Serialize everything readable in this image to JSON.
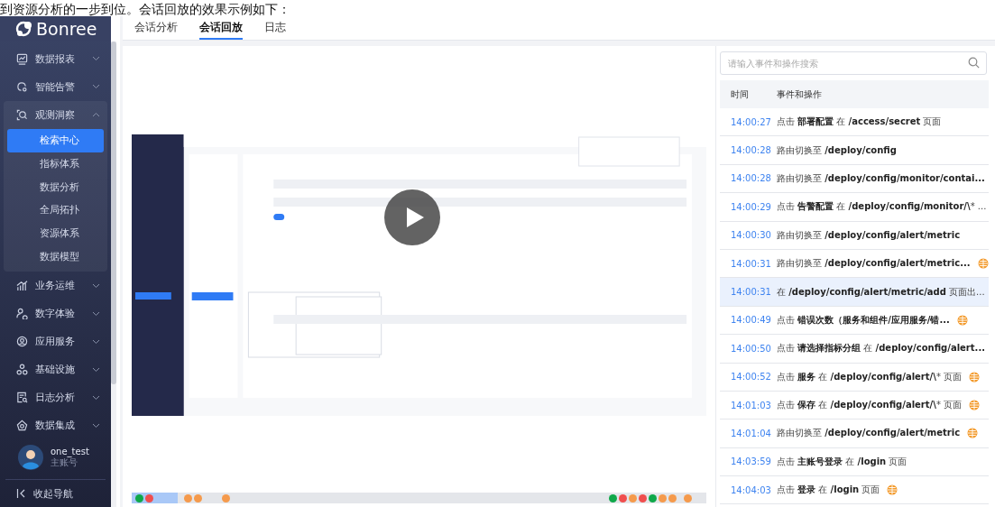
{
  "caption": "到资源分析的一步到位。会话回放的效果示例如下：",
  "sidebar": {
    "logo": "Bonree",
    "items": [
      {
        "label": "数据报表",
        "expanded": false
      },
      {
        "label": "智能告警",
        "expanded": false
      },
      {
        "label": "观测洞察",
        "expanded": true,
        "children": [
          {
            "label": "检索中心",
            "selected": true
          },
          {
            "label": "指标体系",
            "selected": false
          },
          {
            "label": "数据分析",
            "selected": false
          },
          {
            "label": "全局拓扑",
            "selected": false
          },
          {
            "label": "资源体系",
            "selected": false
          },
          {
            "label": "数据模型",
            "selected": false
          }
        ]
      },
      {
        "label": "业务运维",
        "expanded": false
      },
      {
        "label": "数字体验",
        "expanded": false
      },
      {
        "label": "应用服务",
        "expanded": false
      },
      {
        "label": "基础设施",
        "expanded": false
      },
      {
        "label": "日志分析",
        "expanded": false
      },
      {
        "label": "数据集成",
        "expanded": false
      }
    ],
    "user": {
      "name": "one_test",
      "role": "主账号"
    },
    "collapse": "收起导航"
  },
  "tabs": [
    {
      "label": "会话分析",
      "selected": false
    },
    {
      "label": "会话回放",
      "selected": true
    },
    {
      "label": "日志",
      "selected": false
    }
  ],
  "player": {
    "timeline": {
      "level": 0.08,
      "clusters": [
        {
          "markers": [
            {
              "color": "#0fa84a"
            },
            {
              "color": "#f04e4e"
            }
          ]
        },
        {
          "markers": [
            {
              "color": "#f59a4c"
            },
            {
              "color": "#f59a4c"
            }
          ]
        },
        {
          "markers": [
            {
              "color": "#f59a4c"
            }
          ]
        },
        {
          "markers": [
            {
              "color": "#0fa84a"
            },
            {
              "color": "#f04e4e"
            },
            {
              "color": "#f59a4c"
            },
            {
              "color": "#f04e4e"
            },
            {
              "color": "#0fa84a"
            },
            {
              "color": "#f59a4c"
            },
            {
              "color": "#f59a4c"
            }
          ]
        },
        {
          "markers": [
            {
              "color": "#f59a4c"
            }
          ]
        }
      ]
    }
  },
  "events": {
    "search": {
      "placeholder": "请输入事件和操作搜索"
    },
    "columns": [
      "时间",
      "事件和操作"
    ],
    "rows": [
      {
        "time": "14:00:27",
        "text": "点击 **部署配置** 在 **/access/secret** 页面",
        "web": false,
        "selected": false
      },
      {
        "time": "14:00:28",
        "text": "路由切换至 **/deploy/config**",
        "web": false,
        "selected": false
      },
      {
        "time": "14:00:28",
        "text": "路由切换至 **/deploy/config/monitor/contai...**",
        "web": false,
        "selected": false
      },
      {
        "time": "14:00:29",
        "text": "点击 **告警配置** 在 **/deploy/config/monitor/\\*** ...",
        "web": false,
        "selected": false
      },
      {
        "time": "14:00:30",
        "text": "路由切换至 **/deploy/config/alert/metric**",
        "web": false,
        "selected": false
      },
      {
        "time": "14:00:31",
        "text": "路由切换至 **/deploy/config/alert/metric...**",
        "web": true,
        "selected": false
      },
      {
        "time": "14:00:31",
        "text": "在 **/deploy/config/alert/metric/add** 页面出...",
        "web": false,
        "selected": true
      },
      {
        "time": "14:00:49",
        "text": "点击 **错误次数（服务和组件/应用服务/错...**",
        "web": true,
        "selected": false
      },
      {
        "time": "14:00:50",
        "text": "点击 **请选择指标分组** 在 **/deploy/config/alert...**",
        "web": false,
        "selected": false
      },
      {
        "time": "14:00:52",
        "text": "点击 **服务** 在 **/deploy/config/alert/\\*** 页面",
        "web": true,
        "selected": false
      },
      {
        "time": "14:01:03",
        "text": "点击 **保存** 在 **/deploy/config/alert/\\*** 页面",
        "web": true,
        "selected": false
      },
      {
        "time": "14:01:04",
        "text": "路由切换至 **/deploy/config/alert/metric**",
        "web": true,
        "selected": false
      },
      {
        "time": "14:03:59",
        "text": "点击 **主账号登录** 在 **/login** 页面",
        "web": false,
        "selected": false
      },
      {
        "time": "14:04:03",
        "text": "点击 **登录** 在 **/login** 页面",
        "web": true,
        "selected": false
      }
    ]
  }
}
